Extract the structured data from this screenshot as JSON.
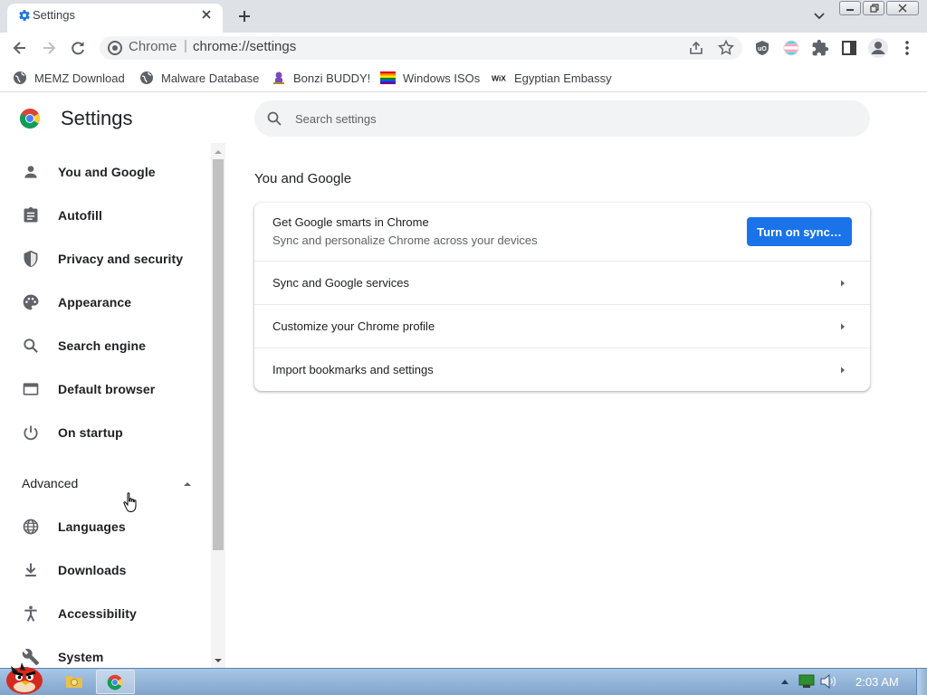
{
  "tab": {
    "title": "Settings",
    "icon": "gear-icon"
  },
  "toolbar": {
    "scheme": "Chrome",
    "separator": "|",
    "url": "chrome://settings"
  },
  "bookmarks": [
    {
      "label": "MEMZ Download",
      "icon": "globe-icon"
    },
    {
      "label": "Malware Database",
      "icon": "globe-icon"
    },
    {
      "label": "Bonzi BUDDY!",
      "icon": "bonzi-icon"
    },
    {
      "label": "Windows ISOs",
      "icon": "rainbow-flag-icon"
    },
    {
      "label": "Egyptian Embassy",
      "icon": "wix-icon"
    }
  ],
  "settings": {
    "title": "Settings",
    "search_placeholder": "Search settings",
    "nav": [
      {
        "label": "You and Google",
        "icon": "person-icon"
      },
      {
        "label": "Autofill",
        "icon": "clipboard-icon"
      },
      {
        "label": "Privacy and security",
        "icon": "shield-icon"
      },
      {
        "label": "Appearance",
        "icon": "palette-icon"
      },
      {
        "label": "Search engine",
        "icon": "search-icon"
      },
      {
        "label": "Default browser",
        "icon": "browser-icon"
      },
      {
        "label": "On startup",
        "icon": "power-icon"
      }
    ],
    "advanced_label": "Advanced",
    "advanced_nav": [
      {
        "label": "Languages",
        "icon": "globe-icon"
      },
      {
        "label": "Downloads",
        "icon": "download-icon"
      },
      {
        "label": "Accessibility",
        "icon": "accessibility-icon"
      },
      {
        "label": "System",
        "icon": "wrench-icon"
      }
    ]
  },
  "main": {
    "section_title": "You and Google",
    "sync": {
      "title": "Get Google smarts in Chrome",
      "subtitle": "Sync and personalize Chrome across your devices",
      "button": "Turn on sync…"
    },
    "rows": [
      "Sync and Google services",
      "Customize your Chrome profile",
      "Import bookmarks and settings"
    ]
  },
  "taskbar": {
    "clock": "2:03 AM"
  },
  "colors": {
    "accent": "#1a73e8",
    "tabstrip": "#dee1e6",
    "omnibox": "#f1f3f4"
  }
}
